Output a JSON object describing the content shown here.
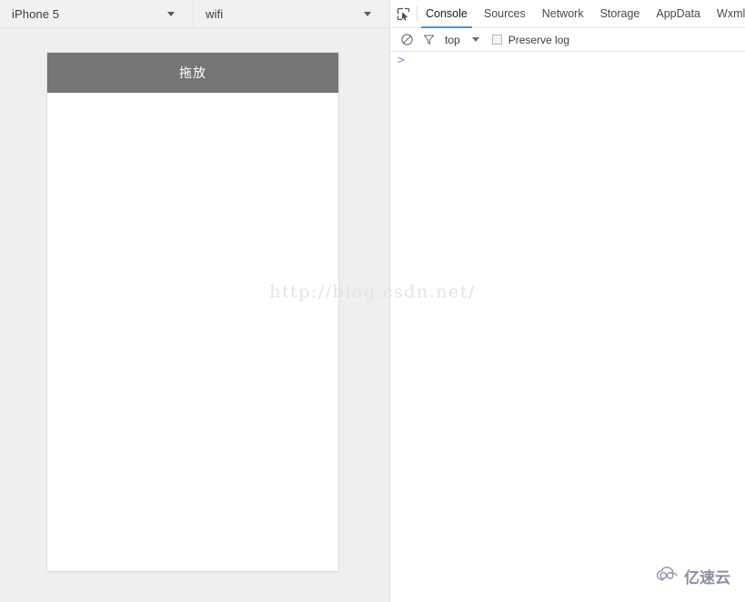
{
  "simulator": {
    "device_select": {
      "value": "iPhone 5",
      "icon": "chevron-down-icon"
    },
    "network_select": {
      "value": "wifi",
      "icon": "chevron-down-icon"
    },
    "phone": {
      "navbar_title": "拖放",
      "navbar_bg": "#757575",
      "navbar_text_color": "#ffffff",
      "body_bg": "#ffffff"
    },
    "background": "#efefef"
  },
  "watermark": {
    "text": "http://blog.csdn.net/",
    "color": "#e3e3e3"
  },
  "devtools": {
    "inspect_icon": "inspect-element-icon",
    "tabs": [
      {
        "label": "Console",
        "active": true
      },
      {
        "label": "Sources",
        "active": false
      },
      {
        "label": "Network",
        "active": false
      },
      {
        "label": "Storage",
        "active": false
      },
      {
        "label": "AppData",
        "active": false
      },
      {
        "label": "Wxml",
        "active": false
      }
    ],
    "active_tab_underline_color": "#4a90d9",
    "toolbar": {
      "clear_icon": "clear-console-icon",
      "filter_icon": "filter-icon",
      "context_value": "top",
      "context_caret_icon": "chevron-down-icon",
      "preserve_log_label": "Preserve log",
      "preserve_log_checked": false
    },
    "console": {
      "prompt": ">",
      "prompt_color": "#7a9cc6",
      "entries": []
    }
  },
  "logo": {
    "text": "亿速云",
    "mark": "cloud-logo-icon",
    "color": "#8a8fa0"
  }
}
